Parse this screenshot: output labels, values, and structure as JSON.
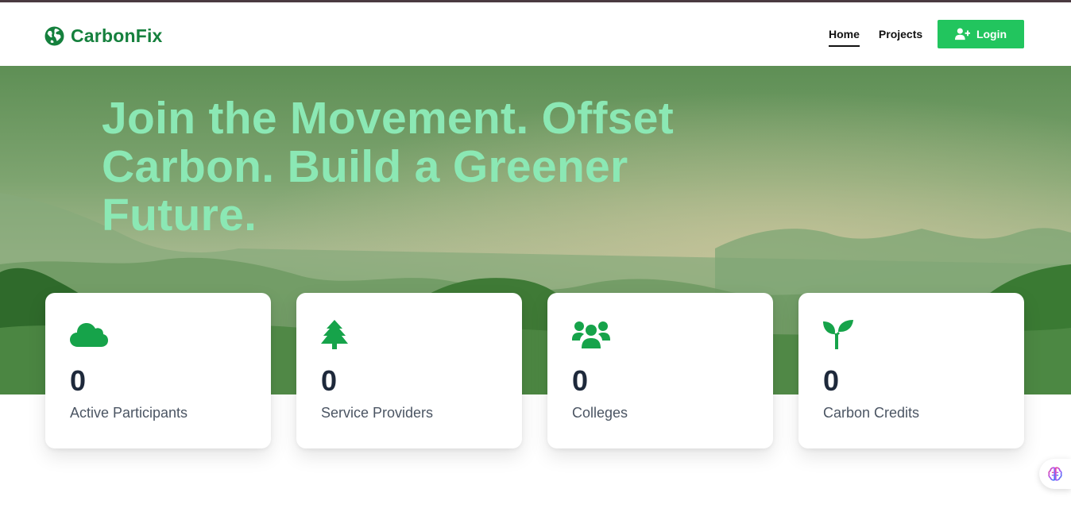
{
  "brand": {
    "name": "CarbonFix",
    "icon": "globe-icon",
    "color": "#15803d"
  },
  "nav": {
    "links": [
      {
        "label": "Home",
        "active": true
      },
      {
        "label": "Projects",
        "active": false
      }
    ],
    "login_label": "Login",
    "login_icon": "user-plus-icon",
    "accent": "#22c55e"
  },
  "hero": {
    "title": "Join the Movement. Offset Carbon. Build a Greener Future."
  },
  "stats": [
    {
      "icon": "cloud-icon",
      "value": "0",
      "label": "Active Participants"
    },
    {
      "icon": "tree-icon",
      "value": "0",
      "label": "Service Providers"
    },
    {
      "icon": "users-icon",
      "value": "0",
      "label": "Colleges"
    },
    {
      "icon": "seedling-icon",
      "value": "0",
      "label": "Carbon Credits"
    }
  ],
  "assistant": {
    "icon": "brain-icon"
  }
}
